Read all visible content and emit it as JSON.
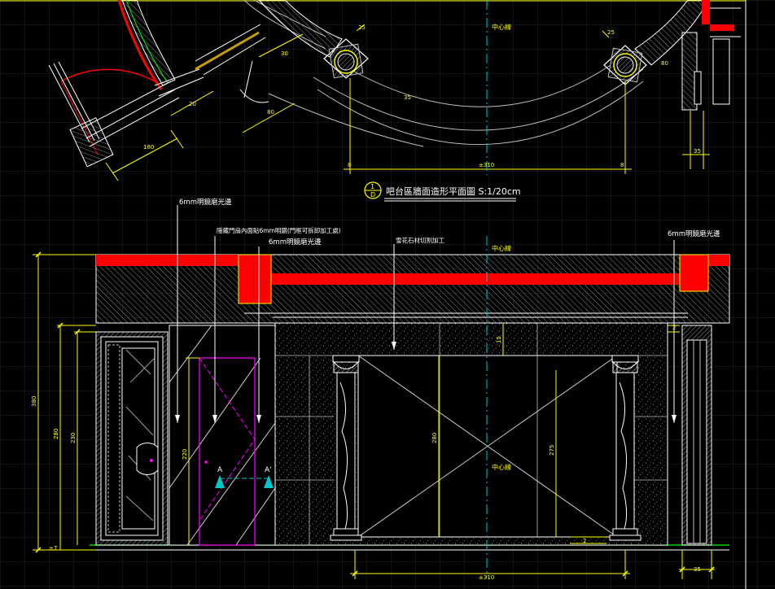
{
  "colors": {
    "background": "#000000",
    "grid": "#2a2a2a",
    "dimension": "#ffff00",
    "outline": "#ffffff",
    "hatch": "#9a9a9a",
    "section_fill": "#ff0000",
    "cut_line": "#ff00ff",
    "center_line": "#00c8c8",
    "floor_line": "#00ff00",
    "arc_line": "#c0c0c0"
  },
  "plan": {
    "title": "吧台區牆面造形平面圖 S:1/20cm",
    "marker_top": "1",
    "marker_bottom": "D",
    "center_label": "中心線",
    "dims": {
      "overall": "±310",
      "left_8": "8",
      "right_8": "8",
      "col_25_left": "25",
      "col_25_right": "25",
      "d_30": "30",
      "d_35": "35",
      "d_80": "80",
      "d_180": "180",
      "d_20": "20",
      "right_35": "35",
      "right_80": "80"
    }
  },
  "elevation": {
    "center_label": "中心線",
    "annotations": {
      "mirror_left": "6mm明鏡磨光邊",
      "mirror_right": "6mm明鏡磨光邊",
      "mirror_mid": "6mm明鏡磨光邊",
      "door_note": "隱藏門扇內面貼6mm明鏡(門框可拆卸加工處)",
      "stone_note": "雪花石材切割加工"
    },
    "dims": {
      "height_total": "380",
      "height_door": "280",
      "height_inner": "230",
      "height_mid": "220",
      "height_center": "280",
      "height_column": "275",
      "overall_bottom": "±310",
      "top_15": "15",
      "top_2": "2",
      "bottom_7": "±7",
      "bottom_2": "2",
      "bottom_right_35": "35",
      "cut_a_left": "A",
      "cut_a_right": "A'"
    }
  }
}
